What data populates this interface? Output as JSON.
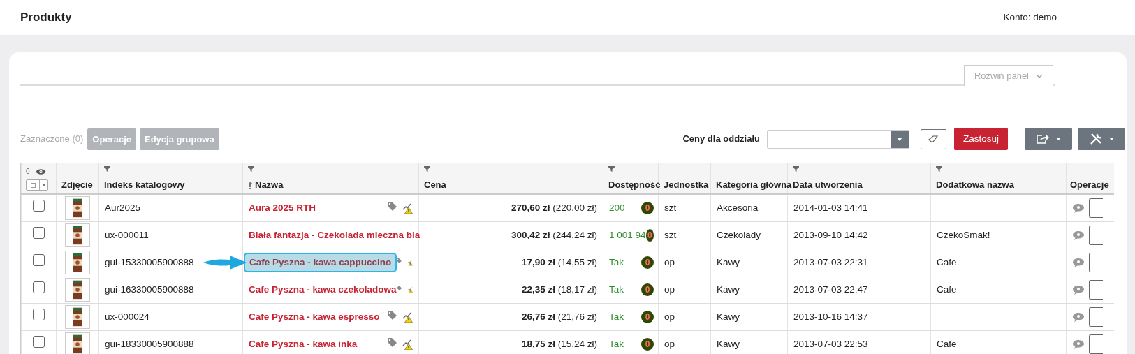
{
  "header": {
    "title": "Produkty",
    "account": "Konto: demo"
  },
  "panel_toggle": {
    "label": "Rozwiń panel",
    "expanded": false
  },
  "toolbar": {
    "selected_count": "Zaznaczone (0)",
    "buttons": [
      {
        "label": "Operacje",
        "disabled": true
      },
      {
        "label": "Edycja grupowa",
        "disabled": true
      }
    ],
    "branch_label": "Ceny dla oddziału",
    "apply": "Zastosuj"
  },
  "table": {
    "visible_count": "0",
    "columns": [
      {
        "label": "Zdjęcie",
        "filter": false,
        "sorted": false
      },
      {
        "label": "Indeks katalogowy",
        "filter": true,
        "sorted": false
      },
      {
        "label": "Nazwa",
        "filter": true,
        "sorted": true
      },
      {
        "label": "Cena",
        "filter": true,
        "sorted": false
      },
      {
        "label": "Dostępność",
        "filter": true,
        "sorted": false
      },
      {
        "label": "Jednostka",
        "filter": false,
        "sorted": false
      },
      {
        "label": "Kategoria główna",
        "filter": false,
        "sorted": false
      },
      {
        "label": "Data utworzenia",
        "filter": true,
        "sorted": false
      },
      {
        "label": "Dodatkowa nazwa",
        "filter": true,
        "sorted": false
      },
      {
        "label": "Operacje",
        "filter": false,
        "sorted": false
      }
    ],
    "rows": [
      {
        "selected": false,
        "highlighted": false,
        "index": "Aur2025",
        "name": "Aura 2025 RTH",
        "price": "**270,60 zł** (220,00 zł)",
        "availability": "200",
        "badge": "0",
        "unit": "szt",
        "category": "Akcesoria",
        "created": "2014-01-03 14:41"
      },
      {
        "selected": false,
        "highlighted": false,
        "index": "ux-000011",
        "name": "Biała fantazja - Czekolada mleczna bia",
        "price": "**300,42 zł** (244,24 zł)",
        "availability": "1 001 94",
        "badge": "0",
        "unit": "szt",
        "category": "Czekolady",
        "created": "2013-09-10 14:42",
        "extra_name": "CzekoSmak!"
      },
      {
        "selected": false,
        "highlighted": true,
        "index": "gui-15330005900888",
        "name": "Cafe Pyszna - kawa cappuccino",
        "price": "**17,90 zł** (14,55 zł)",
        "availability": "Tak",
        "badge": "0",
        "unit": "op",
        "category": "Kawy",
        "created": "2013-07-03 22:31",
        "extra_name": "Cafe"
      },
      {
        "selected": false,
        "highlighted": false,
        "index": "gui-16330005900888",
        "name": "Cafe Pyszna - kawa czekoladowa",
        "price": "**22,35 zł** (18,17 zł)",
        "availability": "Tak",
        "badge": "0",
        "unit": "op",
        "category": "Kawy",
        "created": "2013-07-03 22:47",
        "extra_name": "Cafe"
      },
      {
        "selected": false,
        "highlighted": false,
        "index": "ux-000024",
        "name": "Cafe Pyszna - kawa espresso",
        "price": "**26,76 zł** (21,76 zł)",
        "availability": "Tak",
        "badge": "0",
        "unit": "op",
        "category": "Kawy",
        "created": "2013-10-16 14:37"
      },
      {
        "selected": false,
        "highlighted": false,
        "index": "gui-18330005900888",
        "name": "Cafe Pyszna - kawa inka",
        "price": "**18,75 zł** (15,24 zł)",
        "availability": "Tak",
        "badge": "0",
        "unit": "op",
        "category": "Kawy",
        "created": "2013-07-03 22:53",
        "extra_name": "Cafe"
      }
    ]
  }
}
